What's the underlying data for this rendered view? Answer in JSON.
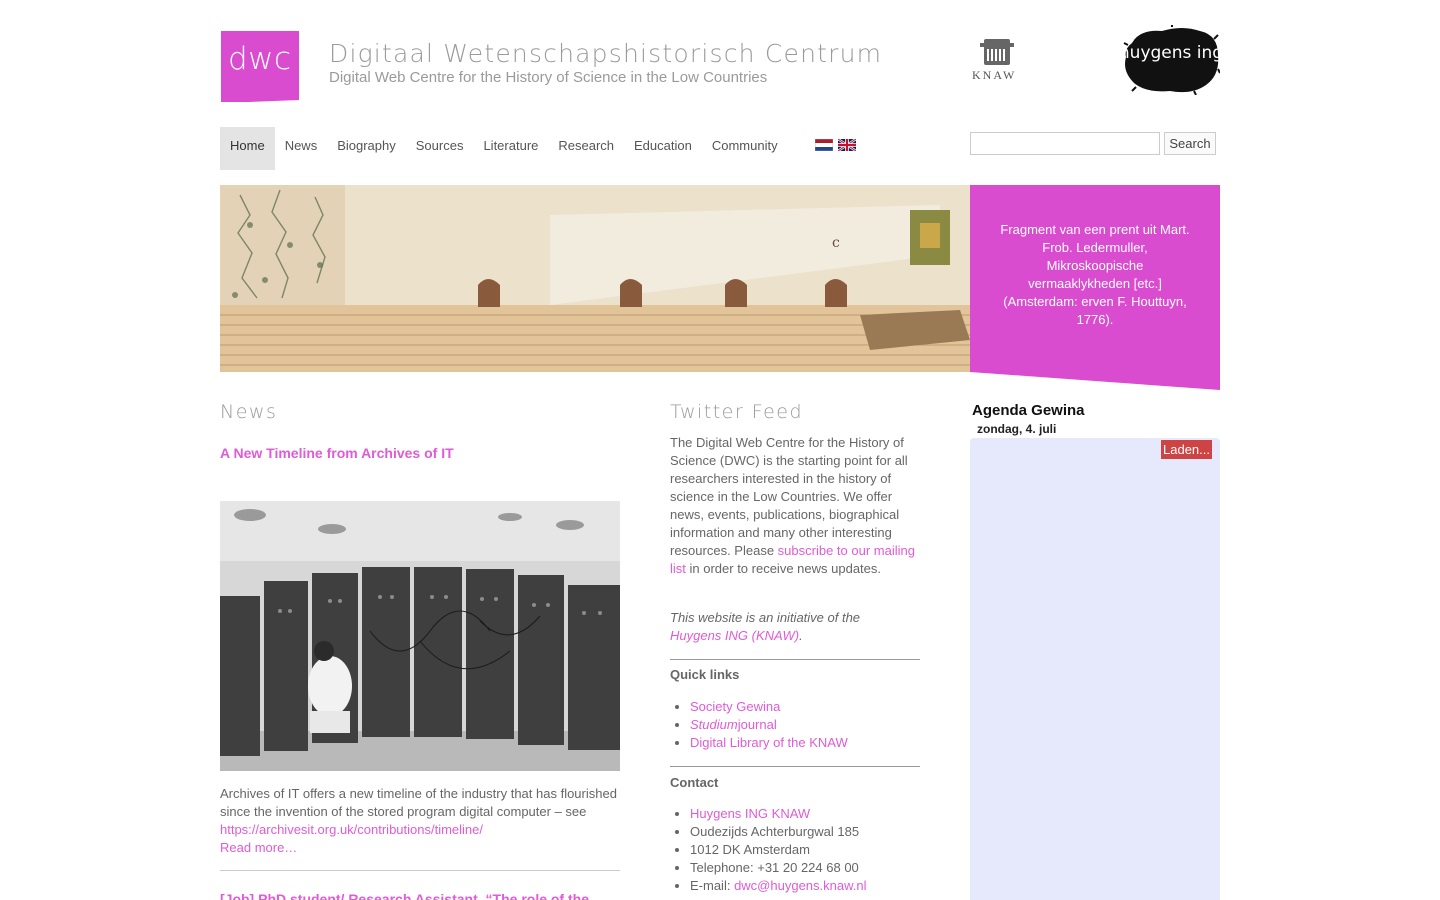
{
  "header": {
    "logo_text": "dwc",
    "title": "Digitaal Wetenschapshistorisch Centrum",
    "subtitle": "Digital Web Centre for the History of Science in the Low Countries",
    "knaw_text": "KNAW",
    "huygens_text": "huygens ing"
  },
  "nav": {
    "items": [
      "Home",
      "News",
      "Biography",
      "Sources",
      "Literature",
      "Research",
      "Education",
      "Community"
    ],
    "active": "Home"
  },
  "search": {
    "placeholder": "",
    "button": "Search"
  },
  "banner": {
    "caption": "Fragment van een prent uit Mart. Frob. Ledermuller, Mikroskoopische vermaaklykheden [etc.] (Amsterdam: erven F. Houttuyn, 1776)."
  },
  "news": {
    "heading": "News",
    "title": "A New Timeline from Archives of IT",
    "body": "Archives of IT offers a new timeline of the industry that has flourished since the invention of the stored program digital computer – see ",
    "link": "https://archivesit.org.uk/contributions/timeline/",
    "read_more": "Read more…",
    "next_title": "[Job] PhD student/ Research Assistant, “The role of the"
  },
  "twitter": {
    "heading": "Twitter Feed",
    "intro": "The Digital Web Centre for the History of Science (DWC) is the starting point for all researchers interested in the history of science in the Low Countries. We offer news, events, publications, biographical information and many other interesting resources. Please ",
    "intro_link": "subscribe to our mailing list",
    "intro_end": " in order to receive news updates.",
    "initiative_text": "This website is an initiative of the ",
    "initiative_link": "Huygens ING (KNAW)",
    "initiative_end": "."
  },
  "quick_links": {
    "heading": "Quick links",
    "items": [
      "Society Gewina",
      "Studium",
      "journal",
      "Digital Library of the KNAW"
    ]
  },
  "contact": {
    "heading": "Contact",
    "link": "Huygens ING KNAW",
    "address1": "Oudezijds Achterburgwal 185",
    "address2": "1012 DK Amsterdam",
    "telephone": "Telephone: +31 20 224 68 00",
    "email_label": "E-mail: ",
    "email": "dwc@huygens.knaw.nl"
  },
  "agenda": {
    "title": "Agenda Gewina",
    "date": "zondag, 4. juli",
    "loading": "Laden..."
  },
  "colors": {
    "brand_pink": "#d94bcf",
    "link_pink": "#e05bd6",
    "agenda_bg": "#e6e9fb",
    "loading_red": "#cc4444"
  }
}
